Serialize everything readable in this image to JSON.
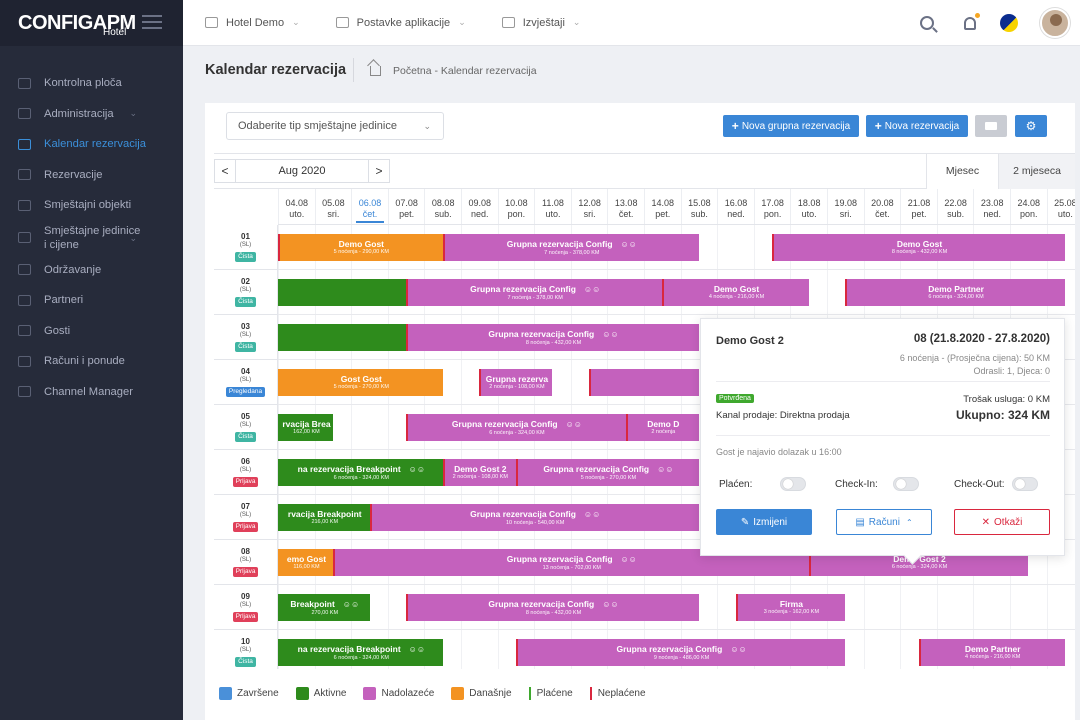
{
  "app": {
    "logo_main": "CONFIGAPM",
    "logo_sub": "Hotel"
  },
  "sidebar": {
    "items": [
      {
        "label": "Kontrolna ploča",
        "icon": "dashboard-icon",
        "chevron": false,
        "active": false
      },
      {
        "label": "Administracija",
        "icon": "admin-icon",
        "chevron": true,
        "active": false
      },
      {
        "label": "Kalendar rezervacija",
        "icon": "calendar-icon",
        "chevron": false,
        "active": true
      },
      {
        "label": "Rezervacije",
        "icon": "reservations-icon",
        "chevron": false,
        "active": false
      },
      {
        "label": "Smještajni objekti",
        "icon": "building-icon",
        "chevron": false,
        "active": false
      },
      {
        "label": "Smještajne jedinice i cijene",
        "icon": "units-icon",
        "chevron": true,
        "active": false
      },
      {
        "label": "Održavanje",
        "icon": "maintenance-icon",
        "chevron": false,
        "active": false
      },
      {
        "label": "Partneri",
        "icon": "partners-icon",
        "chevron": false,
        "active": false
      },
      {
        "label": "Gosti",
        "icon": "guests-icon",
        "chevron": false,
        "active": false
      },
      {
        "label": "Računi i ponude",
        "icon": "invoices-icon",
        "chevron": false,
        "active": false
      },
      {
        "label": "Channel Manager",
        "icon": "channel-icon",
        "chevron": false,
        "active": false
      }
    ]
  },
  "topbar": {
    "nav": [
      {
        "label": "Hotel Demo",
        "icon": "hotel-icon"
      },
      {
        "label": "Postavke aplikacije",
        "icon": "gear-icon"
      },
      {
        "label": "Izvještaji",
        "icon": "reports-icon"
      }
    ]
  },
  "page": {
    "title": "Kalendar rezervacija",
    "breadcrumb": "Početna - Kalendar rezervacija"
  },
  "toolbar": {
    "type_placeholder": "Odaberite tip smještajne jedinice",
    "group_btn": "Nova grupna rezervacija",
    "new_btn": "Nova rezervacija"
  },
  "calendar": {
    "month": "Aug 2020",
    "prev": "<",
    "next": ">",
    "views": [
      "Mjesec",
      "2 mjeseca"
    ],
    "today_index": 2,
    "dates": [
      [
        "04.08",
        "uto."
      ],
      [
        "05.08",
        "sri."
      ],
      [
        "06.08",
        "čet."
      ],
      [
        "07.08",
        "pet."
      ],
      [
        "08.08",
        "sub."
      ],
      [
        "09.08",
        "ned."
      ],
      [
        "10.08",
        "pon."
      ],
      [
        "11.08",
        "uto."
      ],
      [
        "12.08",
        "sri."
      ],
      [
        "13.08",
        "čet."
      ],
      [
        "14.08",
        "pet."
      ],
      [
        "15.08",
        "sub."
      ],
      [
        "16.08",
        "ned."
      ],
      [
        "17.08",
        "pon."
      ],
      [
        "18.08",
        "uto."
      ],
      [
        "19.08",
        "sri."
      ],
      [
        "20.08",
        "čet."
      ],
      [
        "21.08",
        "pet."
      ],
      [
        "22.08",
        "sub."
      ],
      [
        "23.08",
        "ned."
      ],
      [
        "24.08",
        "pon."
      ],
      [
        "25.08",
        "uto."
      ]
    ],
    "rooms": [
      {
        "num": "01",
        "type": "(SL)",
        "status": "Čista"
      },
      {
        "num": "02",
        "type": "(SL)",
        "status": "Čista"
      },
      {
        "num": "03",
        "type": "(SL)",
        "status": "Čista"
      },
      {
        "num": "04",
        "type": "(SL)",
        "status": "Pregledana"
      },
      {
        "num": "05",
        "type": "(SL)",
        "status": "Čista"
      },
      {
        "num": "06",
        "type": "(SL)",
        "status": "Prljava"
      },
      {
        "num": "07",
        "type": "(SL)",
        "status": "Prljava"
      },
      {
        "num": "08",
        "type": "(SL)",
        "status": "Prljava"
      },
      {
        "num": "09",
        "type": "(SL)",
        "status": "Prljava"
      },
      {
        "num": "10",
        "type": "(SL)",
        "status": "Čista"
      }
    ],
    "status_colors": {
      "Čista": "#3fb5a3",
      "Pregledana": "#3a86d6",
      "Prljava": "#e0405a"
    },
    "colors": {
      "orange": "#f39322",
      "green": "#2e8b1c",
      "pink": "#c461bd"
    },
    "bookings": [
      {
        "room": 0,
        "start": 0,
        "end": 4.5,
        "color": "orange",
        "title": "Demo Gost",
        "sub": "5 noćenja - 290,00 KM",
        "group": false,
        "edge": "unpaid"
      },
      {
        "room": 0,
        "start": 4.5,
        "end": 11.5,
        "color": "pink",
        "title": "Grupna rezervacija Config",
        "sub": "7 noćenja - 378,00 KM",
        "group": true,
        "edge": "unpaid"
      },
      {
        "room": 0,
        "start": 13.5,
        "end": 21.5,
        "color": "pink",
        "title": "Demo Gost",
        "sub": "8 noćenja - 432,00 KM",
        "group": false,
        "edge": "unpaid"
      },
      {
        "room": 1,
        "start": 0,
        "end": 3.5,
        "color": "green",
        "title": "",
        "sub": "",
        "group": false,
        "edge": ""
      },
      {
        "room": 1,
        "start": 3.5,
        "end": 10.5,
        "color": "pink",
        "title": "Grupna rezervacija Config",
        "sub": "7 noćenja - 378,00 KM",
        "group": true,
        "edge": "unpaid"
      },
      {
        "room": 1,
        "start": 10.5,
        "end": 14.5,
        "color": "pink",
        "title": "Demo Gost",
        "sub": "4 noćenja - 216,00 KM",
        "group": false,
        "edge": "unpaid"
      },
      {
        "room": 1,
        "start": 15.5,
        "end": 21.5,
        "color": "pink",
        "title": "Demo Partner",
        "sub": "6 noćenja - 324,00 KM",
        "group": false,
        "edge": "unpaid"
      },
      {
        "room": 2,
        "start": 0,
        "end": 3.5,
        "color": "green",
        "title": "",
        "sub": "",
        "group": false,
        "edge": ""
      },
      {
        "room": 2,
        "start": 3.5,
        "end": 11.5,
        "color": "pink",
        "title": "Grupna rezervacija Config",
        "sub": "8 noćenja - 432,00 KM",
        "group": true,
        "edge": "unpaid"
      },
      {
        "room": 3,
        "start": 0,
        "end": 4.5,
        "color": "orange",
        "title": "Gost Gost",
        "sub": "5 noćenja - 270,00 KM",
        "group": false,
        "edge": ""
      },
      {
        "room": 3,
        "start": 5.5,
        "end": 7.5,
        "color": "pink",
        "title": "Grupna rezerva",
        "sub": "2 noćenja - 108,00 KM",
        "group": false,
        "edge": "unpaid"
      },
      {
        "room": 3,
        "start": 8.5,
        "end": 11.5,
        "color": "pink",
        "title": "",
        "sub": "",
        "group": false,
        "edge": "unpaid"
      },
      {
        "room": 4,
        "start": 0,
        "end": 1.5,
        "color": "green",
        "title": "rvacija Brea",
        "sub": "162,00 KM",
        "group": false,
        "edge": ""
      },
      {
        "room": 4,
        "start": 3.5,
        "end": 9.5,
        "color": "pink",
        "title": "Grupna rezervacija Config",
        "sub": "6 noćenja - 324,00 KM",
        "group": true,
        "edge": "unpaid"
      },
      {
        "room": 4,
        "start": 9.5,
        "end": 11.5,
        "color": "pink",
        "title": "Demo D",
        "sub": "2 noćenja",
        "group": false,
        "edge": "unpaid"
      },
      {
        "room": 5,
        "start": 0,
        "end": 4.5,
        "color": "green",
        "title": "na rezervacija Breakpoint",
        "sub": "6 noćenja - 324,00 KM",
        "group": true,
        "edge": ""
      },
      {
        "room": 5,
        "start": 4.5,
        "end": 6.5,
        "color": "pink",
        "title": "Demo Gost 2",
        "sub": "2 noćenja - 108,00 KM",
        "group": false,
        "edge": "unpaid"
      },
      {
        "room": 5,
        "start": 6.5,
        "end": 11.5,
        "color": "pink",
        "title": "Grupna rezervacija Config",
        "sub": "5 noćenja - 270,00 KM",
        "group": true,
        "edge": "unpaid"
      },
      {
        "room": 6,
        "start": 0,
        "end": 2.5,
        "color": "green",
        "title": "rvacija Breakpoint",
        "sub": "216,00 KM",
        "group": false,
        "edge": ""
      },
      {
        "room": 6,
        "start": 2.5,
        "end": 11.5,
        "color": "pink",
        "title": "Grupna rezervacija Config",
        "sub": "10 noćenja - 540,00 KM",
        "group": true,
        "edge": "unpaid"
      },
      {
        "room": 7,
        "start": 0,
        "end": 1.5,
        "color": "orange",
        "title": "emo Gost",
        "sub": "116,00 KM",
        "group": false,
        "edge": ""
      },
      {
        "room": 7,
        "start": 1.5,
        "end": 14.5,
        "color": "pink",
        "title": "Grupna rezervacija Config",
        "sub": "13 noćenja - 702,00 KM",
        "group": true,
        "edge": "unpaid"
      },
      {
        "room": 7,
        "start": 14.5,
        "end": 20.5,
        "color": "pink",
        "title": "Demo Gost 2",
        "sub": "6 noćenja - 324,00 KM",
        "group": false,
        "edge": "unpaid"
      },
      {
        "room": 8,
        "start": 0,
        "end": 2.5,
        "color": "green",
        "title": "Breakpoint",
        "sub": "270,00 KM",
        "group": true,
        "edge": ""
      },
      {
        "room": 8,
        "start": 3.5,
        "end": 11.5,
        "color": "pink",
        "title": "Grupna rezervacija Config",
        "sub": "8 noćenja - 432,00 KM",
        "group": true,
        "edge": "unpaid"
      },
      {
        "room": 8,
        "start": 12.5,
        "end": 15.5,
        "color": "pink",
        "title": "Firma",
        "sub": "3 noćenja - 162,00 KM",
        "group": false,
        "edge": "unpaid"
      },
      {
        "room": 9,
        "start": 0,
        "end": 4.5,
        "color": "green",
        "title": "na rezervacija Breakpoint",
        "sub": "6 noćenja - 324,00 KM",
        "group": true,
        "edge": ""
      },
      {
        "room": 9,
        "start": 6.5,
        "end": 15.5,
        "color": "pink",
        "title": "Grupna rezervacija Config",
        "sub": "9 noćenja - 486,00 KM",
        "group": true,
        "edge": "unpaid"
      },
      {
        "room": 9,
        "start": 17.5,
        "end": 21.5,
        "color": "pink",
        "title": "Demo Partner",
        "sub": "4 noćenja - 216,00 KM",
        "group": false,
        "edge": "unpaid"
      }
    ]
  },
  "legend": [
    {
      "label": "Završene",
      "color": "#4a90d9",
      "kind": "swatch"
    },
    {
      "label": "Aktivne",
      "color": "#2e8b1c",
      "kind": "swatch"
    },
    {
      "label": "Nadolazeće",
      "color": "#c461bd",
      "kind": "swatch"
    },
    {
      "label": "Današnje",
      "color": "#f39322",
      "kind": "swatch"
    },
    {
      "label": "Plaćene",
      "color": "#3fa82e",
      "kind": "line"
    },
    {
      "label": "Neplaćene",
      "color": "#d9273e",
      "kind": "line"
    }
  ],
  "popup": {
    "guest": "Demo Gost 2",
    "room_dates": "08 (21.8.2020 - 27.8.2020)",
    "nights_line": "6 noćenja - (Prosječna cijena): 50 KM",
    "occupants": "Odrasli: 1, Djeca: 0",
    "badge": "Potvrđena",
    "channel": "Kanal prodaje: Direktna prodaja",
    "cost": "Trošak usluga: 0 KM",
    "total": "Ukupno: 324 KM",
    "note": "Gost je najavio dolazak u 16:00",
    "toggles": [
      "Plaćen:",
      "Check-In:",
      "Check-Out:"
    ],
    "edit_btn": "Izmijeni",
    "bills_btn": "Računi",
    "cancel_btn": "Otkaži"
  }
}
